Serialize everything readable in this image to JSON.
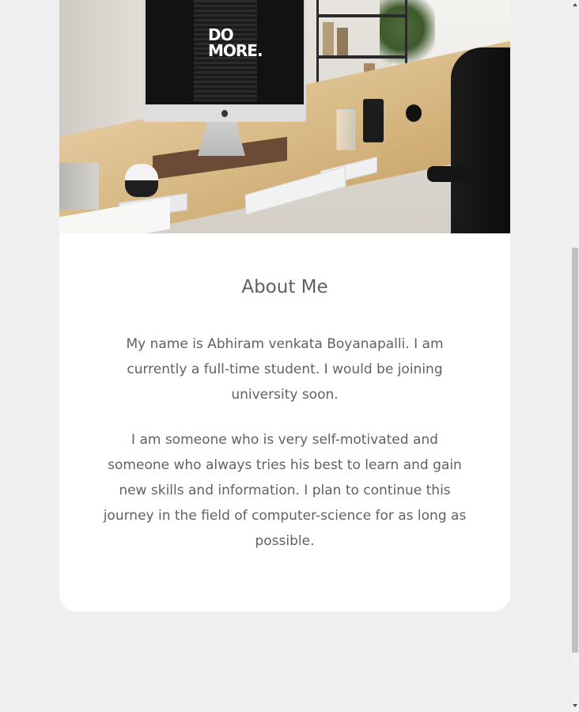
{
  "hero": {
    "image_text": "DO\nMORE.",
    "image_text_line1": "DO",
    "image_text_line2": "MORE."
  },
  "about": {
    "title": "About Me",
    "paragraphs": [
      "My name is Abhiram venkata Boyanapalli. I am currently a full-time student. I would be joining university soon.",
      "I am someone who is very self-motivated and someone who always tries his best to learn and gain new skills and information. I plan to continue this journey in the field of computer-science for as long as possible."
    ]
  },
  "colors": {
    "page_background": "#efefef",
    "card_background": "#ffffff",
    "text": "#616161"
  }
}
